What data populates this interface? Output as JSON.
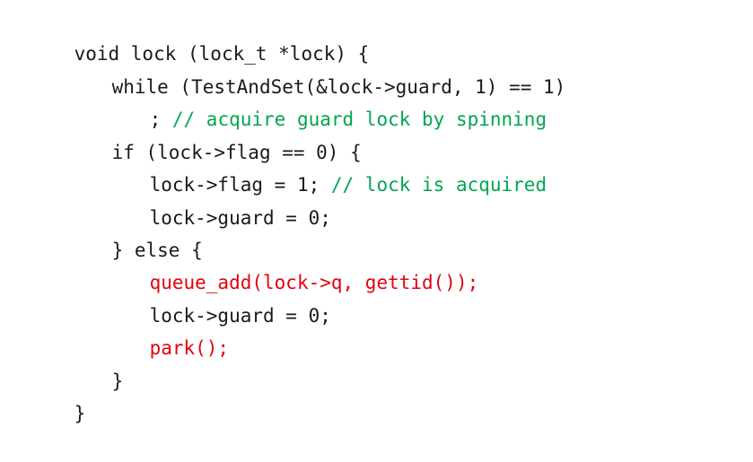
{
  "code": {
    "language": "c",
    "colors": {
      "default": "#1a1a1a",
      "comment": "#00a651",
      "highlight": "#e3000f"
    },
    "lines": [
      {
        "indent": 0,
        "tokens": [
          {
            "text": "void lock (lock_t *lock) {",
            "kind": "default"
          }
        ]
      },
      {
        "indent": 1,
        "tokens": [
          {
            "text": "while (TestAndSet(&lock->guard, 1) == 1)",
            "kind": "default"
          }
        ]
      },
      {
        "indent": 2,
        "tokens": [
          {
            "text": "; ",
            "kind": "default"
          },
          {
            "text": "// acquire guard lock by spinning",
            "kind": "comment"
          }
        ]
      },
      {
        "indent": 1,
        "tokens": [
          {
            "text": "if (lock->flag == 0) {",
            "kind": "default"
          }
        ]
      },
      {
        "indent": 2,
        "tokens": [
          {
            "text": "lock->flag = 1; ",
            "kind": "default"
          },
          {
            "text": "// lock is acquired",
            "kind": "comment"
          }
        ]
      },
      {
        "indent": 2,
        "tokens": [
          {
            "text": "lock->guard = 0;",
            "kind": "default"
          }
        ]
      },
      {
        "indent": 1,
        "tokens": [
          {
            "text": "} else {",
            "kind": "default"
          }
        ]
      },
      {
        "indent": 2,
        "tokens": [
          {
            "text": "queue_add(lock->q, gettid());",
            "kind": "highlight"
          }
        ]
      },
      {
        "indent": 2,
        "tokens": [
          {
            "text": "lock->guard = 0;",
            "kind": "default"
          }
        ]
      },
      {
        "indent": 2,
        "tokens": [
          {
            "text": "park();",
            "kind": "highlight"
          }
        ]
      },
      {
        "indent": 1,
        "tokens": [
          {
            "text": "}",
            "kind": "default"
          }
        ]
      },
      {
        "indent": 0,
        "tokens": [
          {
            "text": "}",
            "kind": "default"
          }
        ]
      }
    ]
  }
}
